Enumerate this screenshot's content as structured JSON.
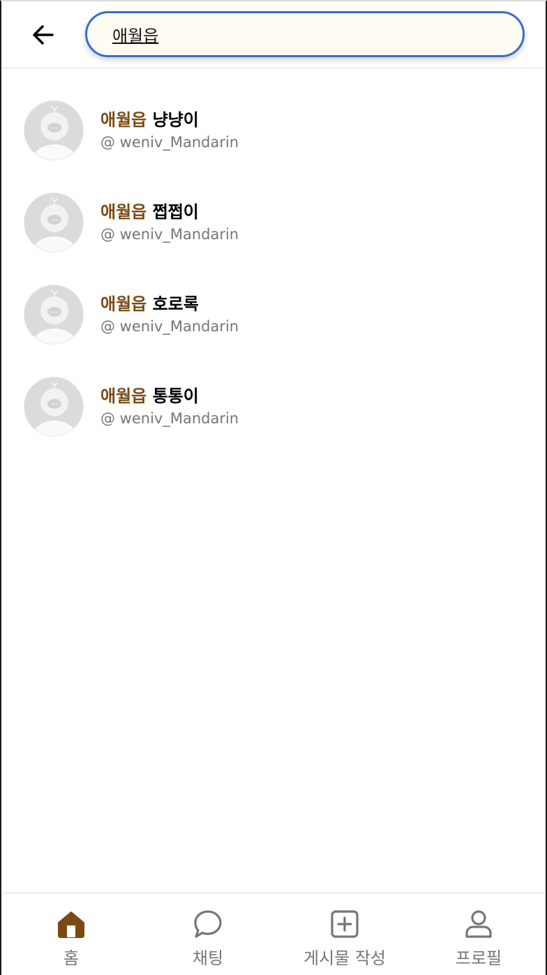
{
  "header": {
    "back_icon": "arrow-left-icon",
    "search_value": "애월읍",
    "search_border_color": "#3b6ad0",
    "search_bg_color": "#fffcf3"
  },
  "results": [
    {
      "highlight": "애월읍",
      "rest": " 냥냥이",
      "handle": "@ weniv_Mandarin"
    },
    {
      "highlight": "애월읍",
      "rest": " 쩝쩝이",
      "handle": "@ weniv_Mandarin"
    },
    {
      "highlight": "애월읍",
      "rest": " 호로록",
      "handle": "@ weniv_Mandarin"
    },
    {
      "highlight": "애월읍",
      "rest": " 통통이",
      "handle": "@ weniv_Mandarin"
    }
  ],
  "highlight_color": "#7a4a14",
  "tabbar": {
    "tabs": [
      {
        "label": "홈",
        "icon": "home-icon",
        "active": true
      },
      {
        "label": "채팅",
        "icon": "chat-bubble-icon",
        "active": false
      },
      {
        "label": "게시물 작성",
        "icon": "plus-square-icon",
        "active": false
      },
      {
        "label": "프로필",
        "icon": "user-icon",
        "active": false
      }
    ],
    "active_color": "#7a4a14",
    "inactive_color": "#767676"
  }
}
